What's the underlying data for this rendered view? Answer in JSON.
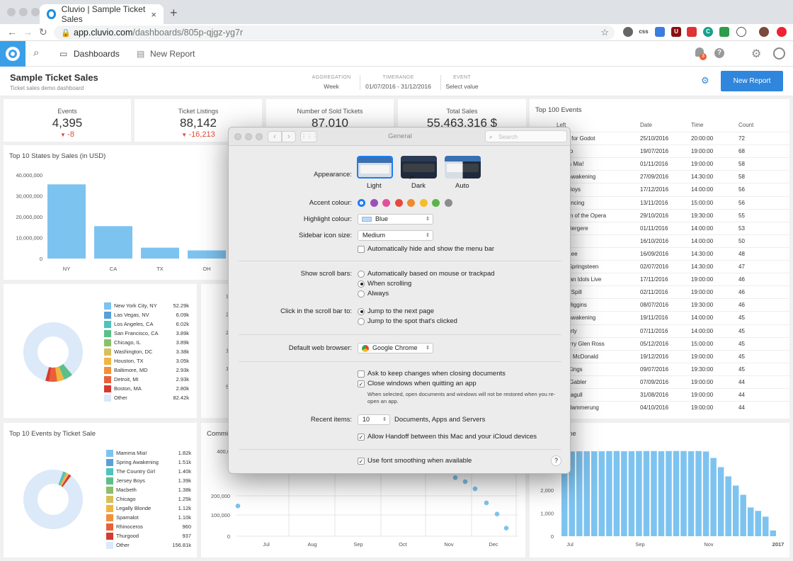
{
  "browser": {
    "tab_title": "Cluvio | Sample Ticket Sales",
    "tab_close": "×",
    "new_tab": "+",
    "url_host": "app.cluvio.com",
    "url_path": "/dashboards/805p-qjgz-yg7r",
    "extensions": [
      "css",
      "U",
      "C"
    ]
  },
  "app": {
    "nav_dashboards": "Dashboards",
    "nav_new_report": "New Report",
    "notif_count": "3",
    "dashboard_title": "Sample Ticket Sales",
    "dashboard_subtitle": "Ticket sales demo dashboard",
    "filters": [
      {
        "key": "AGGREGATION",
        "value": "Week"
      },
      {
        "key": "TIMERANGE",
        "value": "01/07/2016 - 31/12/2016"
      },
      {
        "key": "EVENT",
        "value": "Select value"
      }
    ],
    "new_report_button": "New Report"
  },
  "kpis": [
    {
      "title": "Events",
      "value": "4,395",
      "delta": "-8"
    },
    {
      "title": "Ticket Listings",
      "value": "88,142",
      "delta": "-16,213"
    },
    {
      "title": "Number of Sold Tickets",
      "value": "87,010",
      "delta": ""
    },
    {
      "title": "Total Sales",
      "value": "55,463,316 $",
      "delta": ""
    }
  ],
  "states_chart": {
    "title": "Top 10 States by Sales (in USD)",
    "ticks": [
      "40,000,000",
      "30,000,000",
      "20,000,000",
      "10,000,000",
      "0"
    ]
  },
  "cities_legend": {
    "items": [
      {
        "name": "New York City, NY",
        "value": "52.29k",
        "color": "#7dc3f0"
      },
      {
        "name": "Las Vegas, NV",
        "value": "6.09k",
        "color": "#5a9fd8"
      },
      {
        "name": "Los Angeles, CA",
        "value": "6.02k",
        "color": "#4ec3c0"
      },
      {
        "name": "San Francisco, CA",
        "value": "3.89k",
        "color": "#5cbf8a"
      },
      {
        "name": "Chicago, IL",
        "value": "3.89k",
        "color": "#8cc068"
      },
      {
        "name": "Washington, DC",
        "value": "3.38k",
        "color": "#d7c05a"
      },
      {
        "name": "Houston, TX",
        "value": "3.05k",
        "color": "#f2b440"
      },
      {
        "name": "Baltimore, MD",
        "value": "2.93k",
        "color": "#f28f3b"
      },
      {
        "name": "Detroit, MI",
        "value": "2.93k",
        "color": "#e8603a"
      },
      {
        "name": "Boston, MA",
        "value": "2.80k",
        "color": "#d63a2f"
      },
      {
        "name": "Other",
        "value": "82.42k",
        "color": "#dbe9f8"
      }
    ]
  },
  "mid_axis_ticks": [
    "3,000,0",
    "2,500,0",
    "2,000,0",
    "1,500,0",
    "1,000,0",
    "500,0"
  ],
  "events_chart": {
    "title": "Top 10 Events by Ticket Sale",
    "items": [
      {
        "name": "Mamma Mia!",
        "value": "1.82k",
        "color": "#7dc3f0"
      },
      {
        "name": "Spring Awakening",
        "value": "1.51k",
        "color": "#5a9fd8"
      },
      {
        "name": "The Country Girl",
        "value": "1.40k",
        "color": "#4ec3c0"
      },
      {
        "name": "Jersey Boys",
        "value": "1.39k",
        "color": "#5cbf8a"
      },
      {
        "name": "Macbeth",
        "value": "1.38k",
        "color": "#8cc068"
      },
      {
        "name": "Chicago",
        "value": "1.25k",
        "color": "#d7c05a"
      },
      {
        "name": "Legally Blonde",
        "value": "1.12k",
        "color": "#f2b440"
      },
      {
        "name": "Spamalot",
        "value": "1.10k",
        "color": "#f28f3b"
      },
      {
        "name": "Rhinoceros",
        "value": "960",
        "color": "#e8603a"
      },
      {
        "name": "Thurgood",
        "value": "937",
        "color": "#d63a2f"
      },
      {
        "name": "Other",
        "value": "156.81k",
        "color": "#dbe9f8"
      }
    ]
  },
  "commission_chart": {
    "title": "Commi",
    "ticks": [
      "400,0",
      "200,000",
      "100,000",
      "0"
    ],
    "months": [
      "Jul",
      "Aug",
      "Sep",
      "Oct",
      "Nov",
      "Dec"
    ]
  },
  "over_time_chart": {
    "title": "r time",
    "ticks": [
      "3,000",
      "2,000",
      "1,000",
      "0"
    ],
    "months": [
      "Jul",
      "Sep",
      "Nov",
      "2017"
    ]
  },
  "top_events": {
    "title": "Top 100 Events",
    "headers": [
      "Left",
      "Date",
      "Time",
      "Count"
    ],
    "rows": [
      [
        "ng for Godot",
        "25/10/2016",
        "20:00:00",
        "72"
      ],
      [
        "ago",
        "19/07/2016",
        "19:00:00",
        "68"
      ],
      [
        "ma Mia!",
        "01/11/2016",
        "19:00:00",
        "58"
      ],
      [
        "g Awakening",
        "27/09/2016",
        "14:30:00",
        "58"
      ],
      [
        "y Boys",
        "17/12/2016",
        "14:00:00",
        "56"
      ],
      [
        "Dancing",
        "13/11/2016",
        "15:00:00",
        "56"
      ],
      [
        "tom of the Opera",
        "29/10/2016",
        "19:30:00",
        "55"
      ],
      [
        "s Bergere",
        "01/11/2016",
        "14:00:00",
        "53"
      ],
      [
        "",
        "16/10/2016",
        "14:00:00",
        "50"
      ],
      [
        "s Lee",
        "16/09/2016",
        "14:30:00",
        "48"
      ],
      [
        "e Springsteen",
        "02/07/2016",
        "14:30:00",
        "47"
      ],
      [
        "rican Idols Live",
        "17/11/2016",
        "19:00:00",
        "46"
      ],
      [
        "To Spill",
        "02/11/2016",
        "19:00:00",
        "46"
      ],
      [
        "y Higgins",
        "08/07/2016",
        "19:30:00",
        "46"
      ],
      [
        "g Awakening",
        "19/11/2016",
        "14:00:00",
        "45"
      ],
      [
        "Party",
        "07/11/2016",
        "14:00:00",
        "45"
      ],
      [
        "garry Glen Ross",
        "05/12/2016",
        "15:00:00",
        "45"
      ],
      [
        "ael McDonald",
        "19/12/2016",
        "19:00:00",
        "45"
      ],
      [
        "o Kings",
        "09/07/2016",
        "19:30:00",
        "45"
      ],
      [
        "la Gabler",
        "07/09/2016",
        "19:00:00",
        "44"
      ],
      [
        "Seagull",
        "31/08/2016",
        "19:00:00",
        "44"
      ],
      [
        "erdammerung",
        "04/10/2016",
        "19:00:00",
        "44"
      ]
    ]
  },
  "chart_data": [
    {
      "type": "bar",
      "title": "Top 10 States by Sales (in USD)",
      "categories": [
        "NY",
        "CA",
        "TX",
        "OH"
      ],
      "values": [
        35500000,
        15500000,
        5200000,
        3900000
      ],
      "ylim": [
        0,
        40000000
      ]
    },
    {
      "type": "bar",
      "categories": [
        "Jul",
        "Sep",
        "Nov",
        "2017"
      ],
      "values": [
        2950,
        3680,
        3690,
        3690,
        3690,
        3690,
        3700,
        3700,
        3690,
        3690,
        3700,
        3700,
        3700,
        3690,
        3700,
        3700,
        3700,
        3690,
        3700,
        3680,
        3400,
        3000,
        2600,
        2200,
        1800,
        1250,
        1100,
        850,
        250
      ],
      "ylim": [
        0,
        4000
      ]
    },
    {
      "type": "scatter",
      "title": "Commi",
      "categories": [
        "Jul",
        "Aug",
        "Sep",
        "Oct",
        "Nov",
        "Dec"
      ],
      "values": [
        150000,
        290000,
        270000,
        235000,
        165000,
        110000,
        40000
      ]
    }
  ],
  "dialog": {
    "title": "General",
    "search_placeholder": "Search",
    "appearance_label": "Appearance:",
    "appearance_options": [
      "Light",
      "Dark",
      "Auto"
    ],
    "accent_label": "Accent colour:",
    "accent_colors": [
      "#1f7cf5",
      "#9b4fb8",
      "#e44f9a",
      "#e7473e",
      "#f08a2b",
      "#f6bd2b",
      "#5ab547",
      "#8c8c8c"
    ],
    "highlight_label": "Highlight colour:",
    "highlight_value": "Blue",
    "sidebar_label": "Sidebar icon size:",
    "sidebar_value": "Medium",
    "autohide_label": "Automatically hide and show the menu bar",
    "scrollbars_label": "Show scroll bars:",
    "scroll_opts": [
      "Automatically based on mouse or trackpad",
      "When scrolling",
      "Always"
    ],
    "click_label": "Click in the scroll bar to:",
    "click_opts": [
      "Jump to the next page",
      "Jump to the spot that's clicked"
    ],
    "browser_label": "Default web browser:",
    "browser_value": "Google Chrome",
    "ask_keep": "Ask to keep changes when closing documents",
    "close_windows": "Close windows when quitting an app",
    "close_note": "When selected, open documents and windows will not be restored when you re-open an app.",
    "recent_label": "Recent items:",
    "recent_value": "10",
    "recent_suffix": "Documents, Apps and Servers",
    "handoff": "Allow Handoff between this Mac and your iCloud devices",
    "font_smoothing": "Use font smoothing when available",
    "help": "?"
  }
}
